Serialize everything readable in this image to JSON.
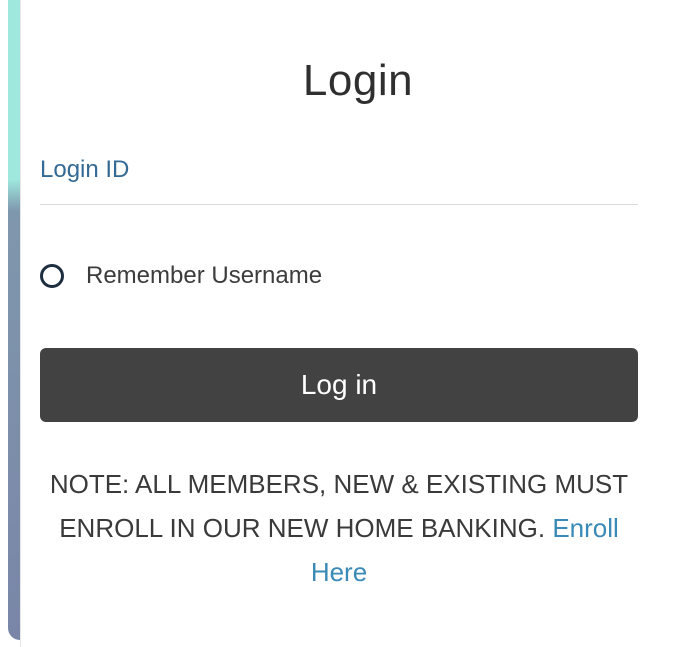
{
  "form": {
    "title": "Login",
    "login_id_label": "Login ID",
    "login_id_value": "",
    "remember_label": "Remember Username",
    "remember_checked": false,
    "submit_label": "Log in"
  },
  "note": {
    "text": "NOTE: ALL MEMBERS, NEW & EXISTING MUST ENROLL IN OUR NEW HOME BANKING.",
    "link_label": "Enroll Here"
  },
  "colors": {
    "label": "#356a94",
    "button": "#424242",
    "link": "#3a8ab7",
    "accent_top": "#9ee8de",
    "accent_bottom": "#7a86a8"
  },
  "icons": {
    "remember_toggle": "radio-circle-icon"
  }
}
